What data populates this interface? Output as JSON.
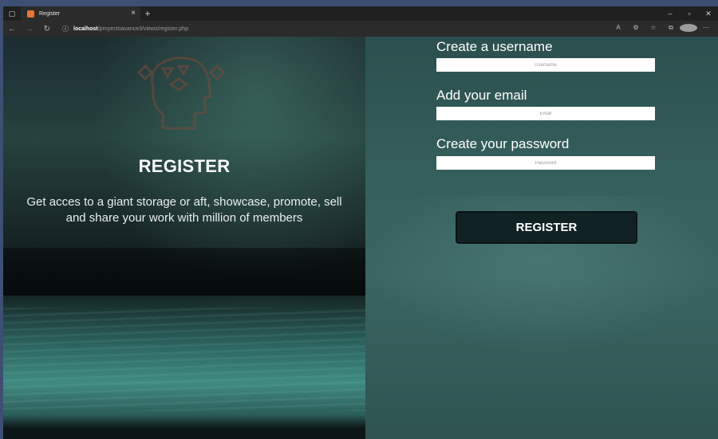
{
  "browser": {
    "tab_title": "Register",
    "tab_close": "×",
    "new_tab": "+",
    "url_host": "localhost",
    "url_path": "/proyectoavance3/views/register.php",
    "window_controls": [
      "–",
      "▫",
      "✕"
    ]
  },
  "hero": {
    "title": "REGISTER",
    "description": "Get acces to a giant storage or aft, showcase, promote, sell and share your work with million of members"
  },
  "form": {
    "username": {
      "label": "Create a username",
      "placeholder": "Username"
    },
    "email": {
      "label": "Add your email",
      "placeholder": "Email"
    },
    "password": {
      "label": "Create your password",
      "placeholder": "Password"
    },
    "submit_label": "REGISTER"
  },
  "colors": {
    "chrome_dark": "#202020",
    "button_bg": "#112224",
    "favicon": "#e8772e"
  }
}
